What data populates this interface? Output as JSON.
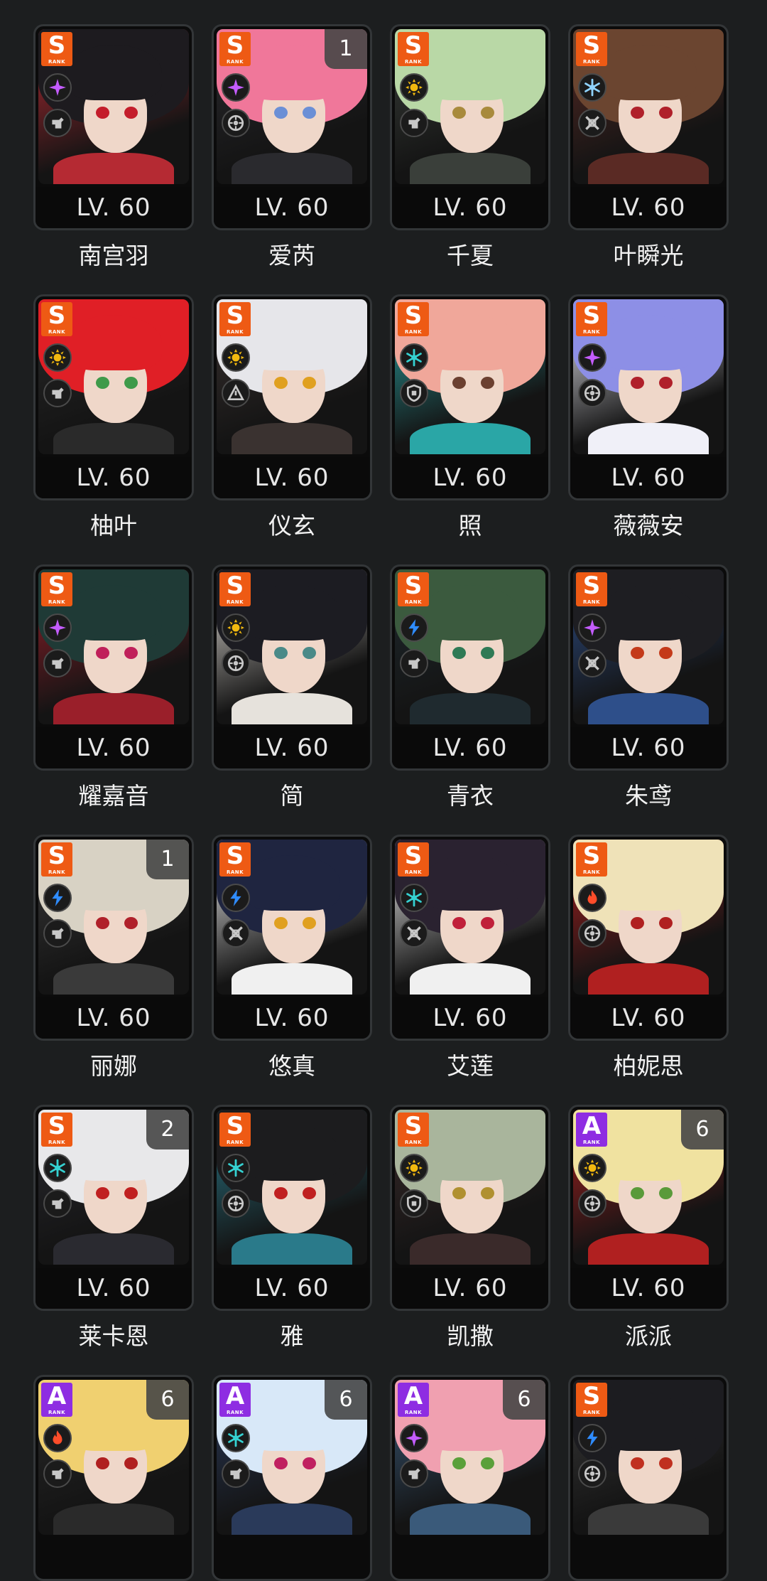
{
  "rank_badge_subtext": "RANK",
  "colors": {
    "background": "#1c1e1f",
    "rank_S": "#ee5a14",
    "rank_A": "#8e2de2",
    "element_ether": "#c45cff",
    "element_physical": "#f2b90f",
    "element_ice": "#8fd3ff",
    "element_fire": "#ff4d2a",
    "element_electric": "#2f8cff",
    "element_frost": "#35d1d1"
  },
  "agents": [
    {
      "name": "南宫羽",
      "level": "LV. 60",
      "rank": "S",
      "element": "ether",
      "role": "stun",
      "cinema": "",
      "hair": "#1d1b1f",
      "eyes": "#c41d2b",
      "outfit": "#b52a33"
    },
    {
      "name": "爱芮",
      "level": "LV. 60",
      "rank": "S",
      "element": "ether",
      "role": "anomaly",
      "cinema": "1",
      "hair": "#f0779a",
      "eyes": "#6b8fd6",
      "outfit": "#2a2a2e"
    },
    {
      "name": "千夏",
      "level": "LV. 60",
      "rank": "S",
      "element": "physical",
      "role": "stun",
      "cinema": "",
      "hair": "#b9d8a6",
      "eyes": "#a88a3c",
      "outfit": "#3a3f3a"
    },
    {
      "name": "叶瞬光",
      "level": "LV. 60",
      "rank": "S",
      "element": "ice",
      "role": "attack",
      "cinema": "",
      "hair": "#6b4530",
      "eyes": "#b0202a",
      "outfit": "#5a2a24"
    },
    {
      "name": "柚叶",
      "level": "LV. 60",
      "rank": "S",
      "element": "physical",
      "role": "stun",
      "cinema": "",
      "hair": "#e01f26",
      "eyes": "#3f9a4a",
      "outfit": "#2a2a2a"
    },
    {
      "name": "仪玄",
      "level": "LV. 60",
      "rank": "S",
      "element": "auric",
      "role": "rupture",
      "cinema": "",
      "hair": "#e6e6ea",
      "eyes": "#e0a020",
      "outfit": "#3a3230"
    },
    {
      "name": "照",
      "level": "LV. 60",
      "rank": "S",
      "element": "frost",
      "role": "defense",
      "cinema": "",
      "hair": "#f0a79a",
      "eyes": "#6b4030",
      "outfit": "#2aa6a6"
    },
    {
      "name": "薇薇安",
      "level": "LV. 60",
      "rank": "S",
      "element": "ether",
      "role": "anomaly",
      "cinema": "",
      "hair": "#8d8fe6",
      "eyes": "#b0202a",
      "outfit": "#f0f0f8"
    },
    {
      "name": "耀嘉音",
      "level": "LV. 60",
      "rank": "S",
      "element": "ether",
      "role": "stun",
      "cinema": "",
      "hair": "#1f3a36",
      "eyes": "#c0205a",
      "outfit": "#9a1f2a"
    },
    {
      "name": "简",
      "level": "LV. 60",
      "rank": "S",
      "element": "physical",
      "role": "anomaly",
      "cinema": "",
      "hair": "#1c1c22",
      "eyes": "#4a8a88",
      "outfit": "#e6e2dc"
    },
    {
      "name": "青衣",
      "level": "LV. 60",
      "rank": "S",
      "element": "electric",
      "role": "stun",
      "cinema": "",
      "hair": "#3b5a3e",
      "eyes": "#2f7a55",
      "outfit": "#1f2a2f"
    },
    {
      "name": "朱鸢",
      "level": "LV. 60",
      "rank": "S",
      "element": "ether",
      "role": "attack",
      "cinema": "",
      "hair": "#1e1e22",
      "eyes": "#c43a1a",
      "outfit": "#2e4f8a"
    },
    {
      "name": "丽娜",
      "level": "LV. 60",
      "rank": "S",
      "element": "electric",
      "role": "stun",
      "cinema": "1",
      "hair": "#d8d2c4",
      "eyes": "#b0202a",
      "outfit": "#3a3a3a"
    },
    {
      "name": "悠真",
      "level": "LV. 60",
      "rank": "S",
      "element": "electric",
      "role": "attack",
      "cinema": "",
      "hair": "#1f2540",
      "eyes": "#e0a020",
      "outfit": "#f0f0f0"
    },
    {
      "name": "艾莲",
      "level": "LV. 60",
      "rank": "S",
      "element": "frost",
      "role": "attack",
      "cinema": "",
      "hair": "#2a2230",
      "eyes": "#c0203a",
      "outfit": "#f0f0f0"
    },
    {
      "name": "柏妮思",
      "level": "LV. 60",
      "rank": "S",
      "element": "fire",
      "role": "anomaly",
      "cinema": "",
      "hair": "#efe2b8",
      "eyes": "#b02020",
      "outfit": "#b02020"
    },
    {
      "name": "莱卡恩",
      "level": "LV. 60",
      "rank": "S",
      "element": "frost",
      "role": "stun",
      "cinema": "2",
      "hair": "#e8e8ea",
      "eyes": "#c02020",
      "outfit": "#2a2a30"
    },
    {
      "name": "雅",
      "level": "LV. 60",
      "rank": "S",
      "element": "frost",
      "role": "anomaly",
      "cinema": "",
      "hair": "#1c1c1e",
      "eyes": "#c02020",
      "outfit": "#2a7a8a"
    },
    {
      "name": "凯撒",
      "level": "LV. 60",
      "rank": "S",
      "element": "physical",
      "role": "defense",
      "cinema": "",
      "hair": "#a9b59c",
      "eyes": "#b09030",
      "outfit": "#3a2a2a"
    },
    {
      "name": "派派",
      "level": "LV. 60",
      "rank": "A",
      "element": "physical",
      "role": "anomaly",
      "cinema": "6",
      "hair": "#f0e2a0",
      "eyes": "#5a9a3a",
      "outfit": "#b02020"
    },
    {
      "name": "",
      "level": "",
      "rank": "A",
      "element": "fire",
      "role": "stun",
      "cinema": "6",
      "hair": "#f0d070",
      "eyes": "#b02020",
      "outfit": "#2a2a2a"
    },
    {
      "name": "",
      "level": "",
      "rank": "A",
      "element": "frost",
      "role": "stun",
      "cinema": "6",
      "hair": "#d8e8f8",
      "eyes": "#c02060",
      "outfit": "#2a3a5a"
    },
    {
      "name": "",
      "level": "",
      "rank": "A",
      "element": "ether",
      "role": "stun",
      "cinema": "6",
      "hair": "#f0a0b0",
      "eyes": "#5aa03a",
      "outfit": "#3a5a7a"
    },
    {
      "name": "",
      "level": "",
      "rank": "S",
      "element": "electric",
      "role": "anomaly",
      "cinema": "",
      "hair": "#1c1c20",
      "eyes": "#c03020",
      "outfit": "#3a3a3a"
    }
  ]
}
